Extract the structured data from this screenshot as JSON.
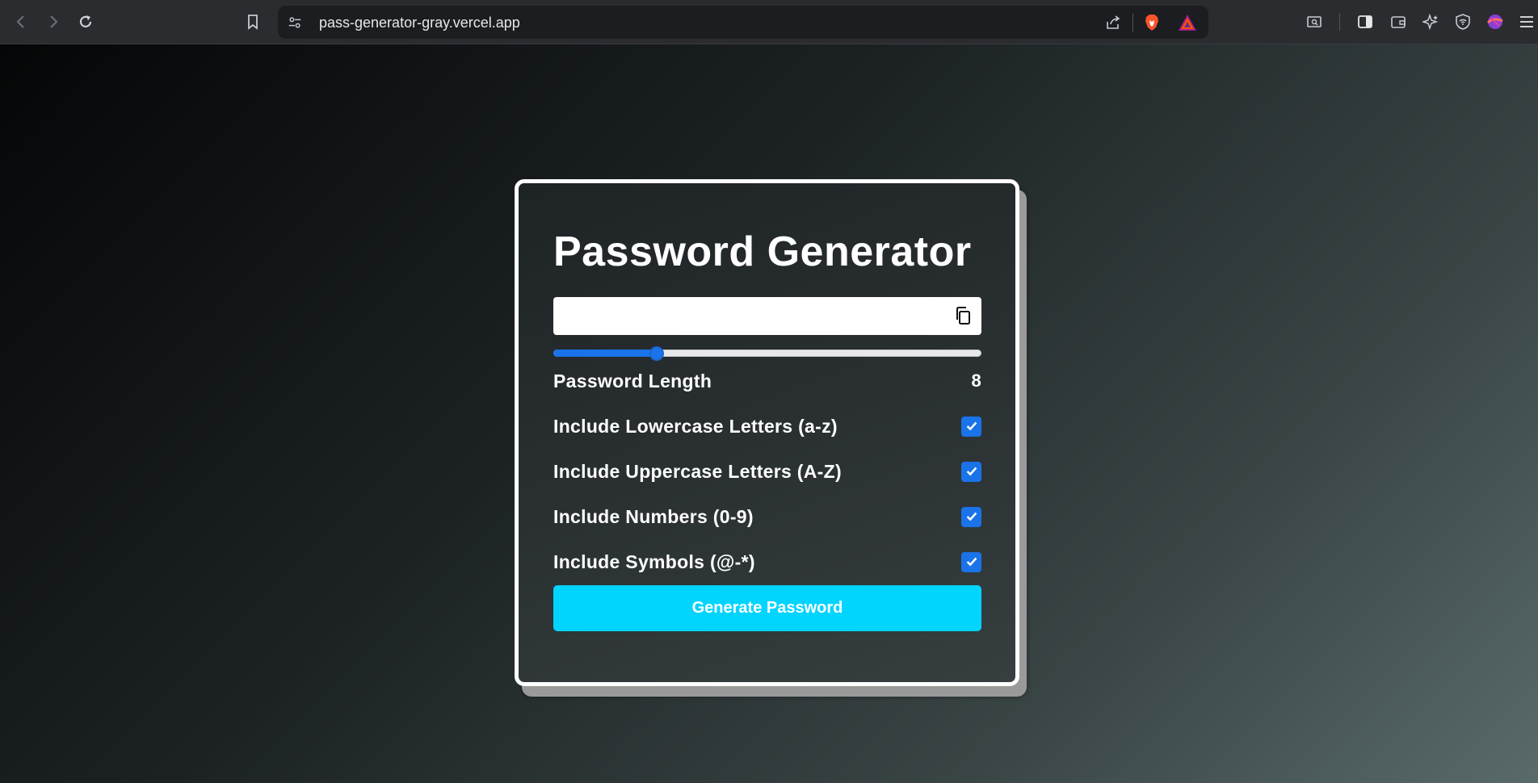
{
  "browser": {
    "url": "pass-generator-gray.vercel.app"
  },
  "app": {
    "title": "Password Generator",
    "password_value": "",
    "length_label": "Password Length",
    "length_value": "8",
    "slider": {
      "value": 8,
      "min": 1,
      "max": 30
    },
    "options": [
      {
        "label": "Include Lowercase Letters (a-z)",
        "checked": true
      },
      {
        "label": "Include Uppercase Letters (A-Z)",
        "checked": true
      },
      {
        "label": "Include Numbers (0-9)",
        "checked": true
      },
      {
        "label": "Include Symbols (@-*)",
        "checked": true
      }
    ],
    "generate_label": "Generate Password"
  },
  "colors": {
    "accent": "#1a73e8",
    "button": "#00d4ff",
    "card_border": "#ffffff"
  }
}
